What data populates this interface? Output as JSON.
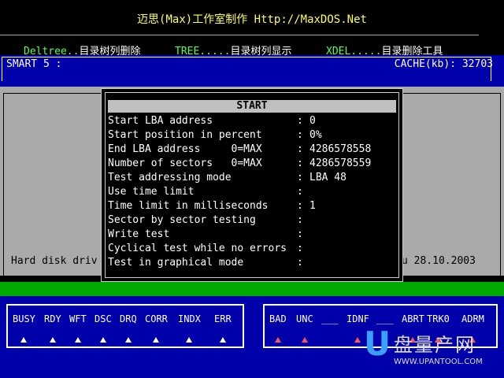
{
  "header": {
    "title": "迈思(Max)工作室制作 Http://MaxDOS.Net",
    "menu": [
      {
        "cmd": "Deltree..",
        "desc": "目录树列删除"
      },
      {
        "cmd": "TREE.....",
        "desc": "目录树列显示"
      },
      {
        "cmd": "XDEL.....",
        "desc": "目录删除工具"
      }
    ]
  },
  "info_bar": {
    "smart": "SMART 5  :",
    "cache": "CACHE(kb): 32703"
  },
  "status_row": {
    "left": "Hard disk driv",
    "right": "u  28.10.2003"
  },
  "dialog": {
    "title": "START",
    "rows": [
      {
        "label": "Start LBA address",
        "value": "0"
      },
      {
        "label": "Start position in percent",
        "value": "0%"
      },
      {
        "label": "End LBA address     0=MAX",
        "value": "4286578558"
      },
      {
        "label": "Number of sectors   0=MAX",
        "value": "4286578559"
      },
      {
        "label": "Test addressing mode",
        "value": "LBA 48"
      },
      {
        "label": "Use time limit",
        "value": ""
      },
      {
        "label": "Time limit in milliseconds",
        "value": "1"
      },
      {
        "label": "Sector by sector testing",
        "value": ""
      },
      {
        "label": "Write test",
        "value": ""
      },
      {
        "label": "Cyclical test while no errors",
        "value": ""
      },
      {
        "label": "Test in graphical mode",
        "value": ""
      }
    ]
  },
  "status_flags": [
    "BUSY",
    "RDY",
    "WFT",
    "DSC",
    "DRQ",
    "CORR",
    "INDX",
    "ERR"
  ],
  "error_flags": [
    "BAD",
    "UNC",
    "___",
    "IDNF",
    "___",
    "ABRT",
    "TRK0",
    "ADRM"
  ],
  "watermark": {
    "letter": "U",
    "text": "盘量产网",
    "url": "WWW.UPANTOOL.COM"
  },
  "colors": {
    "blue": "#0000aa",
    "gray": "#aaaaaa",
    "green": "#00aa00",
    "yellow": "#ffff55",
    "red_arrow": "#ff5555"
  }
}
